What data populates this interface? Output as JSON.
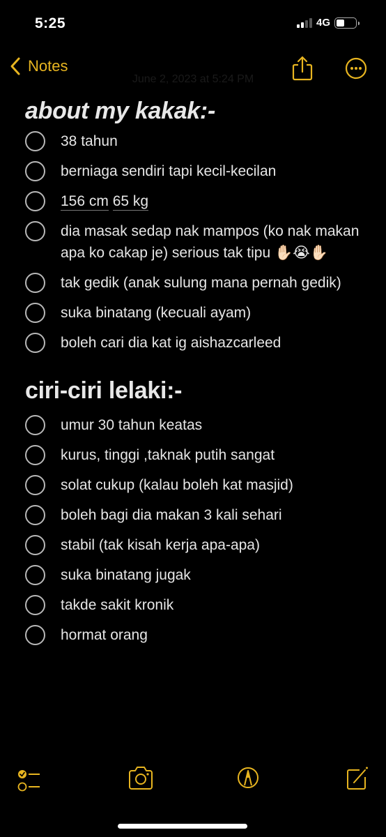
{
  "status_bar": {
    "time": "5:25",
    "network": "4G",
    "signal_bars_active": 2,
    "signal_bars_total": 4,
    "battery_level": 0.45
  },
  "nav": {
    "back_label": "Notes",
    "date": "June 2, 2023 at 5:24 PM",
    "icons": [
      "chevron-left-icon",
      "share-icon",
      "more-icon"
    ]
  },
  "theme": {
    "accent": "#e8b520",
    "background": "#000000",
    "text": "#e6e6e6"
  },
  "note": {
    "sections": [
      {
        "heading": "about my kakak:-",
        "items": [
          {
            "text": "38 tahun",
            "checked": false
          },
          {
            "text": "berniaga sendiri tapi kecil-kecilan",
            "checked": false
          },
          {
            "text": "156 cm 65 kg",
            "checked": false,
            "parts": [
              "156 cm",
              "65 kg"
            ]
          },
          {
            "text": "dia masak sedap nak mampos (ko nak makan apa ko cakap je) serious tak tipu ✋🏻😭✋🏻",
            "checked": false
          },
          {
            "text": "tak gedik (anak sulung mana pernah gedik)",
            "checked": false
          },
          {
            "text": "suka binatang (kecuali ayam)",
            "checked": false
          },
          {
            "text": "boleh cari dia kat ig aishazcarleed",
            "checked": false
          }
        ]
      },
      {
        "heading": "ciri-ciri lelaki:-",
        "items": [
          {
            "text": "umur 30 tahun keatas",
            "checked": false
          },
          {
            "text": "kurus, tinggi ,taknak putih sangat",
            "checked": false
          },
          {
            "text": "solat cukup (kalau boleh kat masjid)",
            "checked": false
          },
          {
            "text": "boleh bagi dia makan 3 kali sehari",
            "checked": false
          },
          {
            "text": "stabil (tak kisah kerja apa-apa)",
            "checked": false
          },
          {
            "text": "suka binatang jugak",
            "checked": false
          },
          {
            "text": "takde sakit kronik",
            "checked": false
          },
          {
            "text": "hormat orang",
            "checked": false
          }
        ]
      }
    ]
  },
  "toolbar": {
    "icons": [
      "checklist-icon",
      "camera-icon",
      "markup-icon",
      "compose-icon"
    ]
  }
}
